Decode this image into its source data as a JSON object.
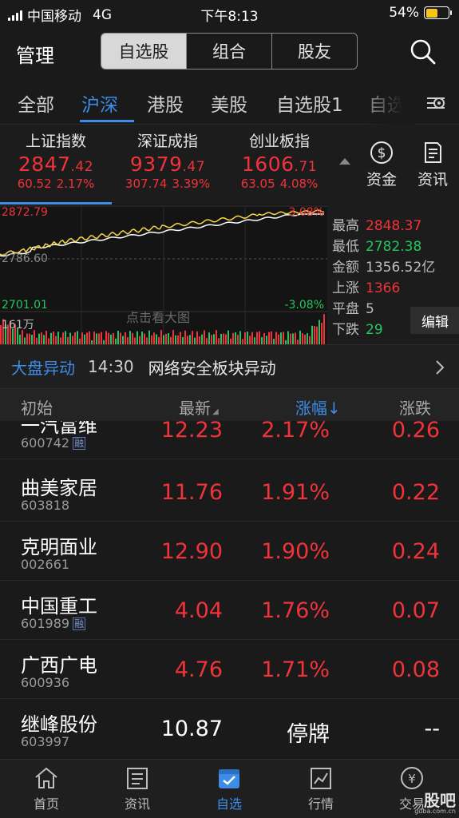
{
  "status_bar": {
    "carrier": "中国移动",
    "network": "4G",
    "time": "下午8:13",
    "battery_text": "54%",
    "battery_level": 0.54
  },
  "header": {
    "title": "管理",
    "segments": [
      "自选股",
      "组合",
      "股友"
    ],
    "active_segment": 0
  },
  "tabs": {
    "items": [
      "全部",
      "沪深",
      "港股",
      "美股",
      "自选股1",
      "自选"
    ],
    "active": 1
  },
  "indices": [
    {
      "name": "上证指数",
      "price_main": "2847",
      "price_dec": ".42",
      "change": "60.52",
      "pct": "2.17%"
    },
    {
      "name": "深证成指",
      "price_main": "9379",
      "price_dec": ".47",
      "change": "307.74",
      "pct": "3.39%"
    },
    {
      "name": "创业板指",
      "price_main": "1606",
      "price_dec": ".71",
      "change": "63.05",
      "pct": "4.08%"
    }
  ],
  "side_buttons": {
    "funds_label": "资金",
    "news_label": "资讯"
  },
  "chart": {
    "price_high": "2872.79",
    "price_ref": "2786.60",
    "price_low": "2701.01",
    "pct_high": "3.08%",
    "pct_low": "-3.08%",
    "volume": "161万",
    "hint": "点击看大图"
  },
  "stats": {
    "high_label": "最高",
    "high_value": "2848.37",
    "low_label": "最低",
    "low_value": "2782.38",
    "amount_label": "金额",
    "amount_value": "1356.52亿",
    "up_label": "上涨",
    "up_value": "1366",
    "flat_label": "平盘",
    "flat_value": "5",
    "down_label": "下跌",
    "down_value": "29",
    "edit_label": "编辑"
  },
  "alert": {
    "label": "大盘异动",
    "time": "14:30",
    "text": "网络安全板块异动"
  },
  "list_header": {
    "col1": "初始",
    "col2": "最新",
    "col3": "涨幅↓",
    "col4": "涨跌"
  },
  "stocks": [
    {
      "name": "一汽富维",
      "code": "600742",
      "rong": "融",
      "price": "12.23",
      "pct": "2.17%",
      "chg": "0.26"
    },
    {
      "name": "曲美家居",
      "code": "603818",
      "rong": "",
      "price": "11.76",
      "pct": "1.91%",
      "chg": "0.22"
    },
    {
      "name": "克明面业",
      "code": "002661",
      "rong": "",
      "price": "12.90",
      "pct": "1.90%",
      "chg": "0.24"
    },
    {
      "name": "中国重工",
      "code": "601989",
      "rong": "融",
      "price": "4.04",
      "pct": "1.76%",
      "chg": "0.07"
    },
    {
      "name": "广西广电",
      "code": "600936",
      "rong": "",
      "price": "4.76",
      "pct": "1.71%",
      "chg": "0.08"
    },
    {
      "name": "继峰股份",
      "code": "603997",
      "rong": "",
      "price": "10.87",
      "pct": "停牌",
      "chg": "--"
    }
  ],
  "tabbar": {
    "items": [
      "首页",
      "资讯",
      "自选",
      "行情",
      "交易"
    ],
    "active": 2
  },
  "watermark": {
    "main": "股吧",
    "sub": "guba.com.cn"
  },
  "colors": {
    "up": "#f0333a",
    "down": "#22c55e",
    "accent": "#3d8ce8",
    "index_line": "#f5d547",
    "avg_line": "#ffffff"
  }
}
